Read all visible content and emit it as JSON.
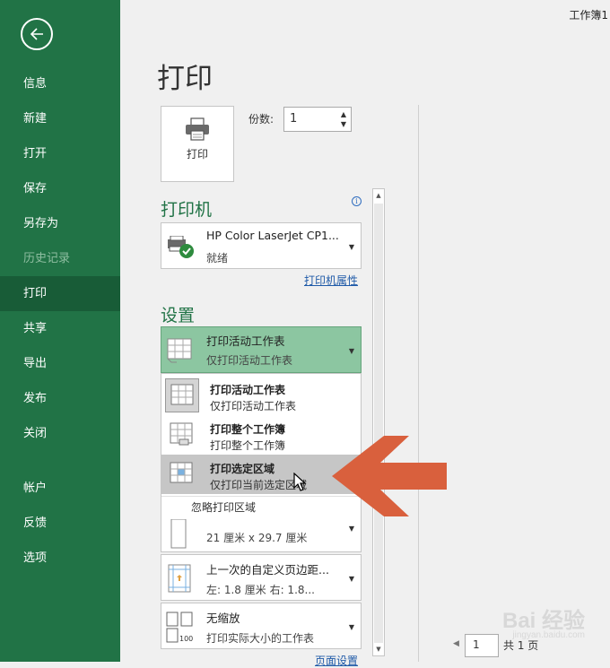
{
  "sidebar": {
    "items": [
      {
        "label": "信息",
        "state": "normal"
      },
      {
        "label": "新建",
        "state": "normal"
      },
      {
        "label": "打开",
        "state": "normal"
      },
      {
        "label": "保存",
        "state": "normal"
      },
      {
        "label": "另存为",
        "state": "normal"
      },
      {
        "label": "历史记录",
        "state": "disabled"
      },
      {
        "label": "打印",
        "state": "active"
      },
      {
        "label": "共享",
        "state": "normal"
      },
      {
        "label": "导出",
        "state": "normal"
      },
      {
        "label": "发布",
        "state": "normal"
      },
      {
        "label": "关闭",
        "state": "normal"
      },
      {
        "label": "帐户",
        "state": "normal"
      },
      {
        "label": "反馈",
        "state": "normal"
      },
      {
        "label": "选项",
        "state": "normal"
      }
    ]
  },
  "document_title": "工作簿1",
  "page_title": "打印",
  "print_button_label": "打印",
  "copies": {
    "label": "份数:",
    "value": "1"
  },
  "printer": {
    "heading": "打印机",
    "name": "HP Color LaserJet CP1...",
    "status": "就绪",
    "properties_link": "打印机属性"
  },
  "settings": {
    "heading": "设置",
    "print_what": {
      "title": "打印活动工作表",
      "subtitle": "仅打印活动工作表"
    },
    "options": [
      {
        "title": "打印活动工作表",
        "subtitle": "仅打印活动工作表"
      },
      {
        "title": "打印整个工作簿",
        "subtitle": "打印整个工作簿"
      },
      {
        "title": "打印选定区域",
        "subtitle": "仅打印当前选定区域"
      }
    ],
    "ignore_print_area": "忽略打印区域",
    "paper_size": "21 厘米 x 29.7 厘米",
    "margins": {
      "title": "上一次的自定义页边距...",
      "subtitle": "左:  1.8 厘米     右:  1.8..."
    },
    "scaling": {
      "title": "无缩放",
      "subtitle": "打印实际大小的工作表"
    },
    "page_setup_link": "页面设置"
  },
  "page_nav": {
    "current": "1",
    "total_text": "共 1 页"
  },
  "watermark": {
    "text": "Bai 经验",
    "sub": "jingyan.baidu.com"
  },
  "colors": {
    "sidebar": "#217346",
    "active_nav": "#185c37",
    "accent_green": "#217346",
    "highlight": "#8cc6a1",
    "arrow": "#d9603d"
  }
}
